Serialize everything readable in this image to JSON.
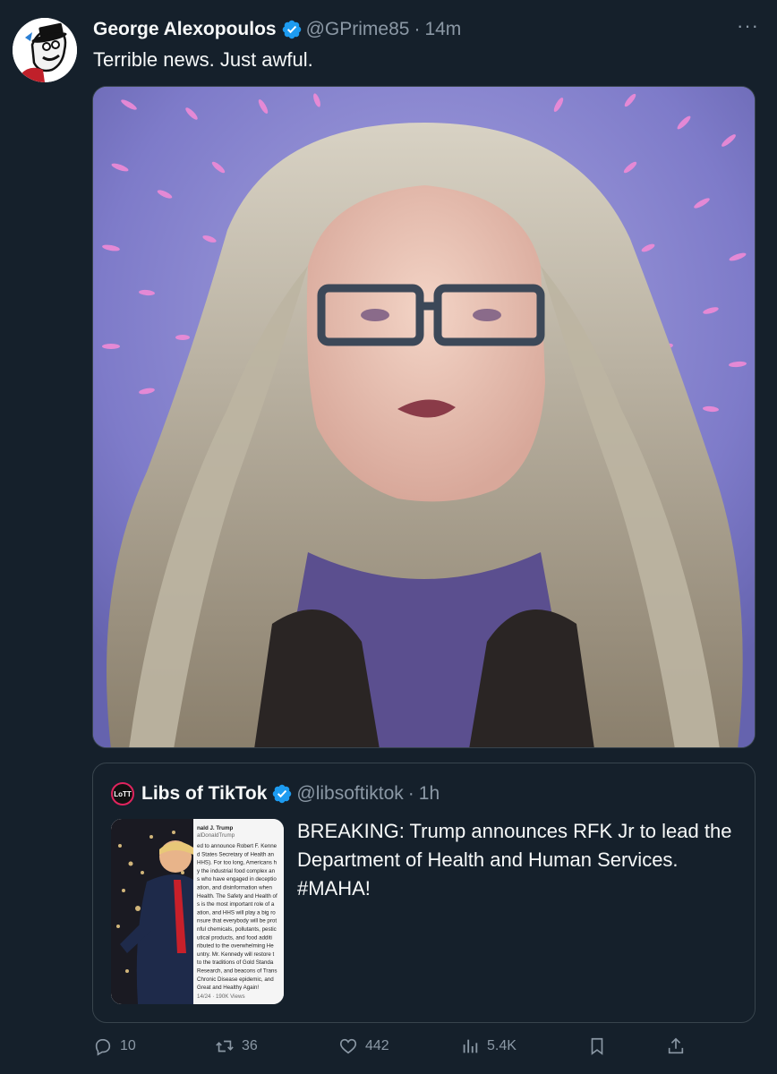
{
  "tweet": {
    "author_name": "George Alexopoulos",
    "handle": "@GPrime85",
    "time": "14m",
    "text": "Terrible news. Just awful.",
    "more_label": "···"
  },
  "quote": {
    "author_name": "Libs of TikTok",
    "handle": "@libsoftiktok",
    "time": "1h",
    "text": "BREAKING: Trump announces RFK Jr to lead the Department of Health and Human Services. #MAHA!",
    "thumb": {
      "header_name": "nald J. Trump",
      "header_handle": "alDonaldTrump",
      "lines": [
        "ed to announce Robert F. Kenne",
        "d States Secretary of Health an",
        "HHS). For too long, Americans h",
        "y the industrial food complex an",
        "s who have engaged in deceptio",
        "ation, and disinformation when",
        "Health. The Safety and Health of",
        "s is the most important role of a",
        "ation, and HHS will play a big ro",
        "nsure that everybody will be prot",
        "nful chemicals, pollutants, pestic",
        "utical products, and food additi",
        "ributed to the overwhelming He",
        "untry. Mr. Kennedy will restore t",
        "to the traditions of Gold Standa",
        "Research, and beacons of Trans",
        "Chronic Disease epidemic, and",
        "Great and Healthy Again!"
      ],
      "footer": "14/24 · 190K Views"
    }
  },
  "actions": {
    "replies": "10",
    "reposts": "36",
    "likes": "442",
    "views": "5.4K"
  },
  "icons": {
    "verified": "verified-badge-icon",
    "reply": "reply-icon",
    "repost": "repost-icon",
    "like": "heart-icon",
    "views": "views-icon",
    "bookmark": "bookmark-icon",
    "share": "share-icon"
  },
  "colors": {
    "background": "#15202b",
    "text_primary": "#f7f9f9",
    "text_muted": "#8b98a5",
    "verified": "#1d9bf0",
    "border": "#38444d"
  }
}
